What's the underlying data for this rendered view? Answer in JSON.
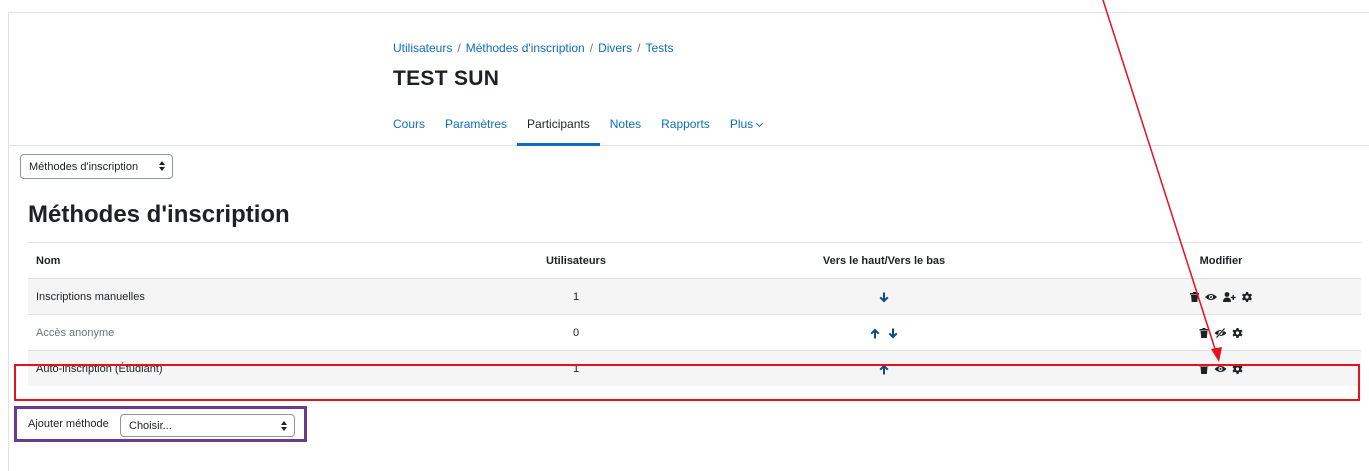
{
  "breadcrumb": {
    "items": [
      "Utilisateurs",
      "Méthodes d'inscription",
      "Divers",
      "Tests"
    ],
    "separator": "/"
  },
  "course": {
    "title": "TEST SUN"
  },
  "tabs": [
    {
      "label": "Cours"
    },
    {
      "label": "Paramètres"
    },
    {
      "label": "Participants",
      "active": true
    },
    {
      "label": "Notes"
    },
    {
      "label": "Rapports"
    },
    {
      "label": "Plus"
    }
  ],
  "nav_select": {
    "value": "Méthodes d'inscription"
  },
  "section": {
    "title": "Méthodes d'inscription"
  },
  "table": {
    "headers": {
      "name": "Nom",
      "users": "Utilisateurs",
      "move": "Vers le haut/Vers le bas",
      "edit": "Modifier"
    },
    "rows": [
      {
        "name": "Inscriptions manuelles",
        "users": "1",
        "move": [
          "down"
        ],
        "edit": [
          "trash-icon",
          "eye-icon",
          "enrol-users-icon",
          "gear-icon"
        ]
      },
      {
        "name": "Accès anonyme",
        "users": "0",
        "move": [
          "up",
          "down"
        ],
        "edit": [
          "trash-icon",
          "eye-slash-icon",
          "gear-icon"
        ],
        "disabled": true
      },
      {
        "name": "Auto-inscription (Étudiant)",
        "users": "1",
        "move": [
          "up"
        ],
        "edit": [
          "trash-icon",
          "eye-icon",
          "gear-icon"
        ]
      }
    ]
  },
  "add_method": {
    "label": "Ajouter méthode",
    "select_value": "Choisir..."
  },
  "colors": {
    "link": "#0f6cbf",
    "annotation_red": "#e8101d",
    "annotation_purple": "#6a3c8f",
    "icon": "#1d2125",
    "arrow_icon": "#0f4c81"
  }
}
